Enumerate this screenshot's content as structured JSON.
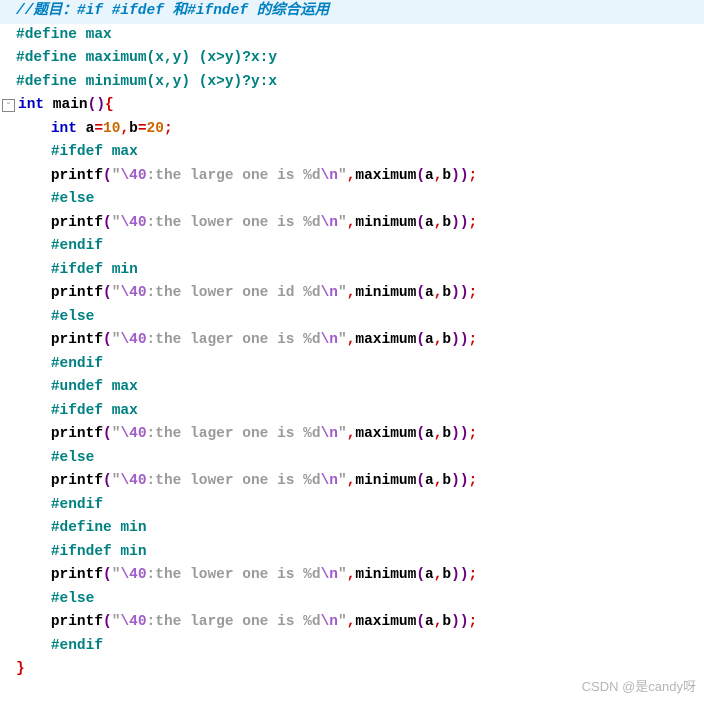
{
  "watermark": "CSDN @是candy呀",
  "code": {
    "comment": "//题目：#if #ifdef 和#ifndef 的综合运用",
    "def_max": "#define max",
    "def_maximum": "#define maximum(x,y) (x>y)?x:y",
    "def_minimum": "#define minimum(x,y) (x>y)?y:x",
    "int_kw": "int",
    "main_name": " main",
    "int_decl": "int",
    "var_a": " a",
    "eq": "=",
    "ten": "10",
    "twenty": "20",
    "var_b": "b",
    "semi": ";",
    "comma": ",",
    "lp": "(",
    "rp": ")",
    "lb": "{",
    "rb": "}",
    "ifdef_max": "#ifdef max",
    "ifdef_min": "#ifdef min",
    "ifndef_min": "#ifndef min",
    "else": "#else",
    "endif": "#endif",
    "undef_max": "#undef max",
    "define_min": "#define min",
    "printf": "printf",
    "maximum": "maximum",
    "minimum": "minimum",
    "a": "a",
    "b": "b",
    "q": "\"",
    "esc40": "\\40",
    "escd": "\\n",
    "s_large": ":the large one is %d",
    "s_lower": ":the lower one is %d",
    "s_lower_id": ":the lower one id %d",
    "s_lager": ":the lager one is %d"
  }
}
